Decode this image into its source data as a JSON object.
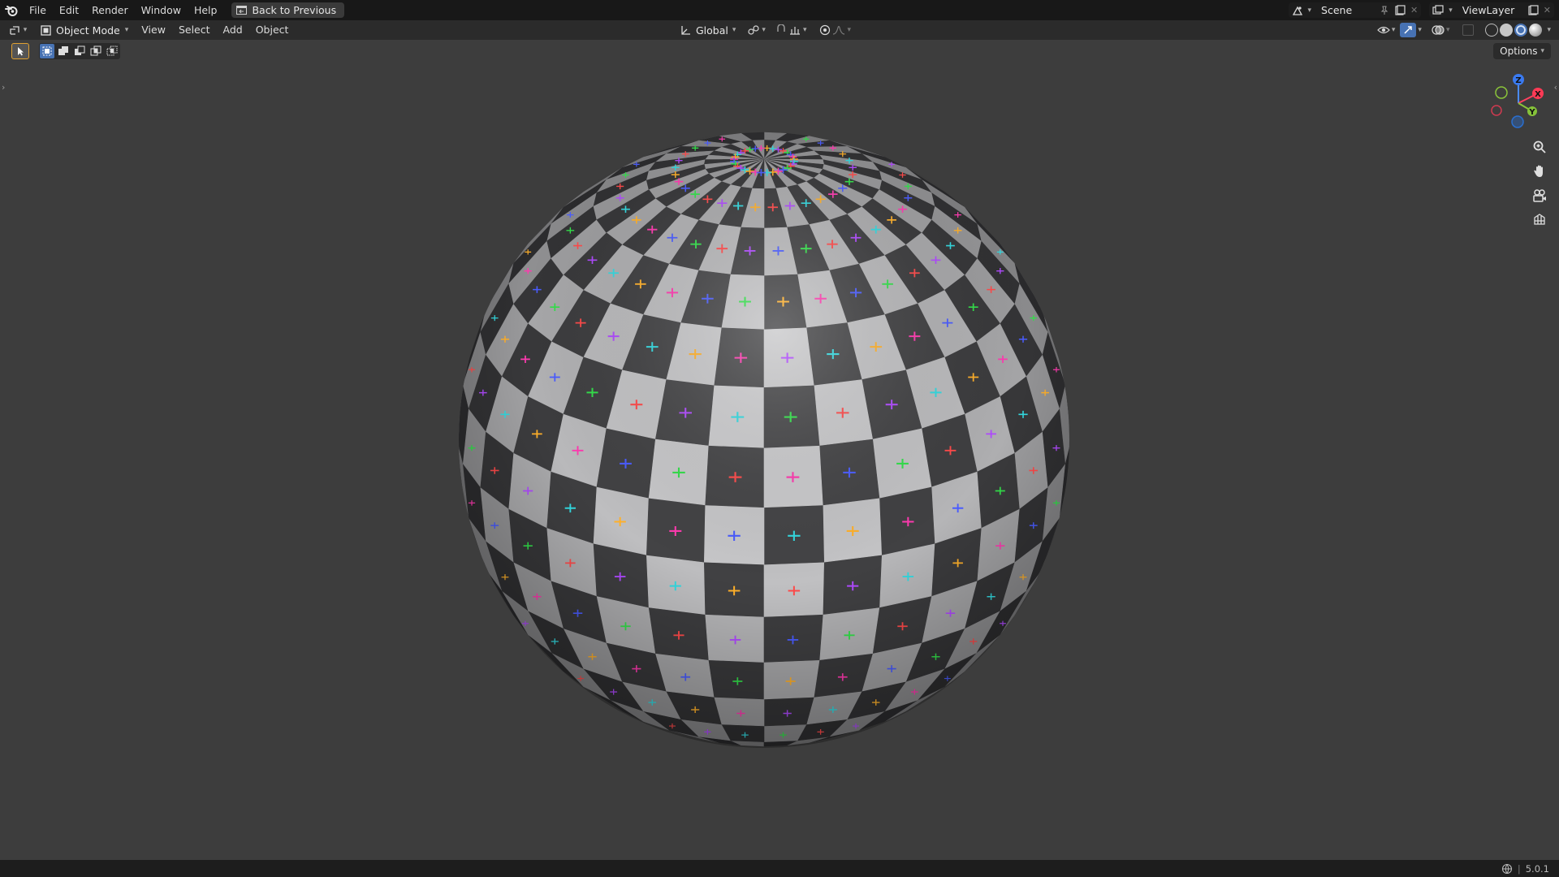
{
  "topbar": {
    "menus": [
      "File",
      "Edit",
      "Render",
      "Window",
      "Help"
    ],
    "back_label": "Back to Previous",
    "scene_name": "Scene",
    "view_layer": "ViewLayer"
  },
  "header": {
    "mode": "Object Mode",
    "menus": [
      "View",
      "Select",
      "Add",
      "Object"
    ],
    "orientation": "Global"
  },
  "toolbar": {
    "options_label": "Options"
  },
  "gizmo": {
    "x": "X",
    "y": "Y",
    "z": "Z"
  },
  "status": {
    "version": "5.0.1"
  },
  "colors": {
    "accent": "#4772b3",
    "marks": [
      "#ff4a4a",
      "#ffb02a",
      "#33e04a",
      "#33d9e0",
      "#4a5cff",
      "#b04aff",
      "#ff3ab0"
    ]
  },
  "icons": [
    "blender-logo-icon",
    "editor-type-icon",
    "object-mode-icon",
    "transform-orientation-icon",
    "pivot-icon",
    "snap-icon",
    "proportional-edit-icon",
    "overlay-icon",
    "gizmo-icon",
    "zoom-icon",
    "hand-icon",
    "camera-icon",
    "grid-icon"
  ]
}
